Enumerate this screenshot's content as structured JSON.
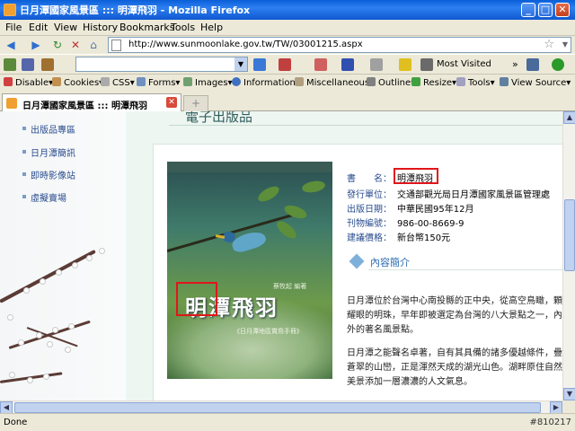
{
  "window": {
    "title": "日月潭國家風景區 ::: 明潭飛羽 - Mozilla Firefox",
    "controls": {
      "minimize": "_",
      "maximize": "□",
      "close": "✕"
    }
  },
  "menu": [
    "File",
    "Edit",
    "View",
    "History",
    "Bookmarks",
    "Tools",
    "Help"
  ],
  "nav": {
    "url": "http://www.sunmoonlake.gov.tw/TW/03001215.aspx",
    "search_value": ""
  },
  "bookmarks": {
    "most_visited": "Most Visited",
    "overflow": "»"
  },
  "devbar": [
    "Disable",
    "Cookies",
    "CSS",
    "Forms",
    "Images",
    "Information",
    "Miscellaneous",
    "Outline",
    "Resize",
    "Tools",
    "View Source"
  ],
  "tab": {
    "label": "日月潭國家風景區 ::: 明潭飛羽",
    "new_tab": "+"
  },
  "sidebar": {
    "items": [
      {
        "label": "出版品專區"
      },
      {
        "label": "日月潭簡訊"
      },
      {
        "label": "即時影像站"
      },
      {
        "label": "虛擬賣場"
      }
    ]
  },
  "page": {
    "section_header": "電子出版品",
    "cover": {
      "title": "明潭飛羽",
      "author": "蔡牧起 編著",
      "subtitle": "《日月潭地區賞鳥手冊》"
    },
    "info": [
      {
        "key": "書　　名：",
        "value": "明潭飛羽"
      },
      {
        "key": "發行單位：",
        "value": "交通部觀光局日月潭國家風景區管理處"
      },
      {
        "key": "出版日期：",
        "value": "中華民國95年12月"
      },
      {
        "key": "刊物編號：",
        "value": "986-00-8669-9"
      },
      {
        "key": "建議價格：",
        "value": "新台幣150元"
      }
    ],
    "content_section_title": "內容簡介",
    "paragraphs": [
      "日月潭位於台灣中心南投縣的正中央，從高空鳥瞰，顆耀眼的明珠，早年即被選定為台灣的八大景點之一，內外的著名風景點。",
      "日月潭之能聲名卓著，自有其具備的諸多優越條件，疊蒼翠的山巒，正是渾然天成的湖光山色。湖畔原住自然美景添加一層濃濃的人文氣息。"
    ]
  },
  "status": {
    "text": "Done",
    "watermark": "#810217"
  },
  "colors": {
    "highlight": "#e0161a",
    "link": "#2a4d8f",
    "titlebar": "#0a5fd8"
  }
}
